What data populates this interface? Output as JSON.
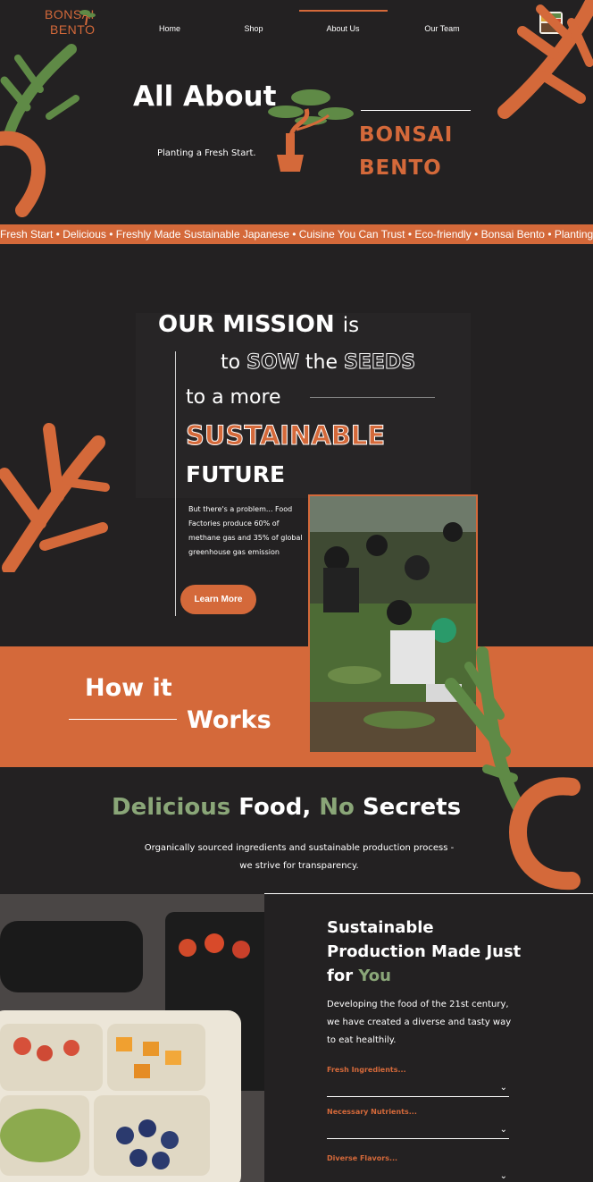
{
  "nav": {
    "logo_line1": "BONSAI",
    "logo_line2": "BENTO",
    "items": [
      {
        "label": "Home"
      },
      {
        "label": "Shop"
      },
      {
        "label": "About Us",
        "active": true
      },
      {
        "label": "Our Team"
      }
    ]
  },
  "hero": {
    "title": "All About",
    "tagline": "Planting a Fresh Start.",
    "brand_line1": "BONSAI",
    "brand_line2": "BENTO"
  },
  "ticker": {
    "text": "Fresh Start • Delicious • Freshly Made Sustainable Japanese • Cuisine You Can Trust • Eco-friendly • Bonsai Bento • Planting a"
  },
  "mission": {
    "line1_bold": "OUR MISSION",
    "line1_thin": "is",
    "line2_to": "to",
    "line2_sow": "SOW",
    "line2_the": "the",
    "line2_seeds": "SEEDS",
    "line3": "to a more",
    "line4": "SUSTAINABLE",
    "line5": "FUTURE",
    "problem": "But there's a problem... Food Factories produce 60% of methane gas and 35% of global greenhouse gas emission",
    "cta": "Learn More"
  },
  "how": {
    "line1": "How it",
    "line2": "Works"
  },
  "delicious": {
    "w1": "Delicious",
    "w2": "Food,",
    "w3": "No",
    "w4": "Secrets",
    "subtitle": "Organically sourced ingredients and sustainable production process - we strive for transparency."
  },
  "sustainable": {
    "title_main": "Sustainable Production Made Just for",
    "title_accent": "You",
    "text": "Developing the food of the 21st century, we have created a diverse and tasty way to eat healthily.",
    "accordion": [
      {
        "label": "Fresh Ingredients..."
      },
      {
        "label": "Necessary Nutrients..."
      },
      {
        "label": "Diverse Flavors..."
      }
    ]
  },
  "colors": {
    "accent": "#d4693a",
    "green": "#8aa678",
    "leaf": "#5f8a46",
    "bg": "#232122"
  }
}
